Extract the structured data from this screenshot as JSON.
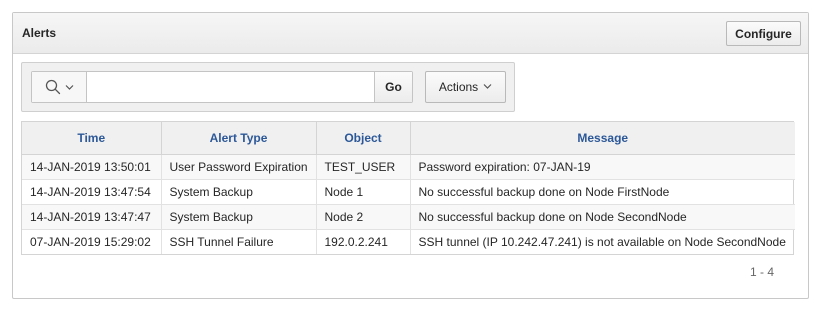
{
  "region": {
    "title": "Alerts",
    "configure_label": "Configure"
  },
  "toolbar": {
    "search_icon": "search-icon",
    "chevron_icon": "chevron-down-icon",
    "search_value": "",
    "go_label": "Go",
    "actions_label": "Actions"
  },
  "table": {
    "headers": [
      "Time",
      "Alert Type",
      "Object",
      "Message"
    ],
    "rows": [
      [
        "14-JAN-2019 13:50:01",
        "User Password Expiration",
        "TEST_USER",
        "Password expiration: 07-JAN-19"
      ],
      [
        "14-JAN-2019 13:47:54",
        "System Backup",
        "Node 1",
        "No successful backup done on Node FirstNode"
      ],
      [
        "14-JAN-2019 13:47:47",
        "System Backup",
        "Node 2",
        "No successful backup done on Node SecondNode"
      ],
      [
        "07-JAN-2019 15:29:02",
        "SSH Tunnel Failure",
        "192.0.2.241",
        "SSH tunnel (IP 10.242.47.241) is not available on Node SecondNode"
      ]
    ]
  },
  "pagination": {
    "range": "1 - 4"
  },
  "colors": {
    "header_text": "#2c5898",
    "row_alt": "#f8f8f8"
  }
}
